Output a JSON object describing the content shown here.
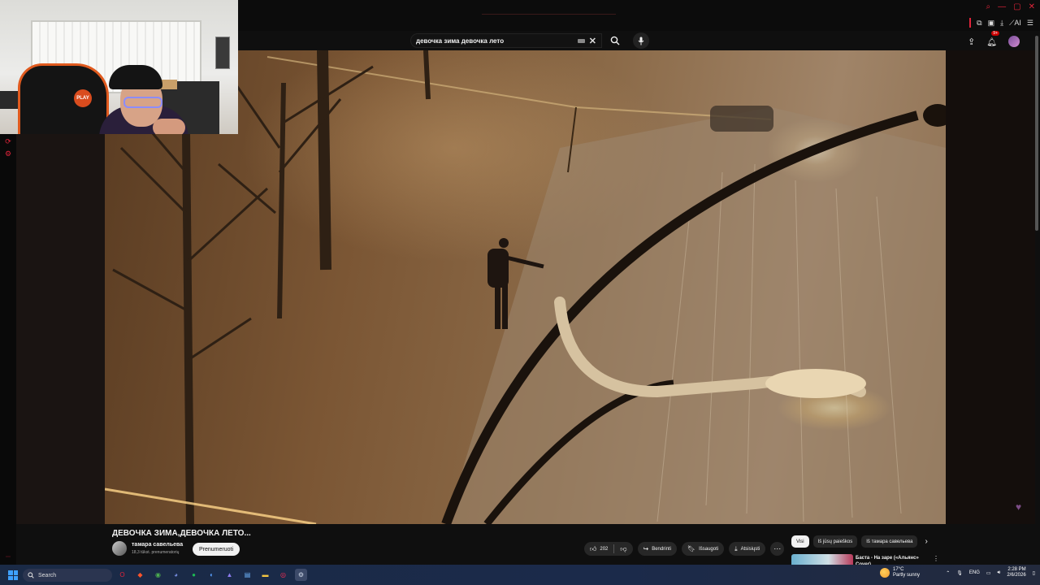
{
  "search": {
    "query": "девочка зима девочка лето"
  },
  "header": {
    "notification_count": "9+"
  },
  "extensions": {
    "ai_label": "AI"
  },
  "webcam": {
    "chair_logo": "PLAY"
  },
  "video": {
    "title": "ДЕВОЧКА ЗИМА,ДЕВОЧКА ЛЕТО...",
    "channel_name": "тамара савельева",
    "subscribers": "18,3 tūkst. prenumeratorių",
    "subscribe_label": "Prenumeruoti",
    "likes": "202",
    "share_label": "Bendrinti",
    "save_label": "Išsaugoti",
    "download_label": "Atsisiųsti"
  },
  "sidebar": {
    "chips": [
      "Visi",
      "Iš jūsų paieškos",
      "Iš тамара савельева"
    ],
    "rec_title": "Баста - На заре («Альянс» Cover)"
  },
  "taskbar": {
    "search_placeholder": "Search",
    "weather_temp": "17°C",
    "weather_desc": "Partly sunny",
    "language": "ENG",
    "time": "2:28 PM",
    "date": "2/6/2026"
  },
  "colors": {
    "accent": "#e0243a",
    "youtube_bg": "#0f0f0f",
    "pill_bg": "#272727"
  }
}
